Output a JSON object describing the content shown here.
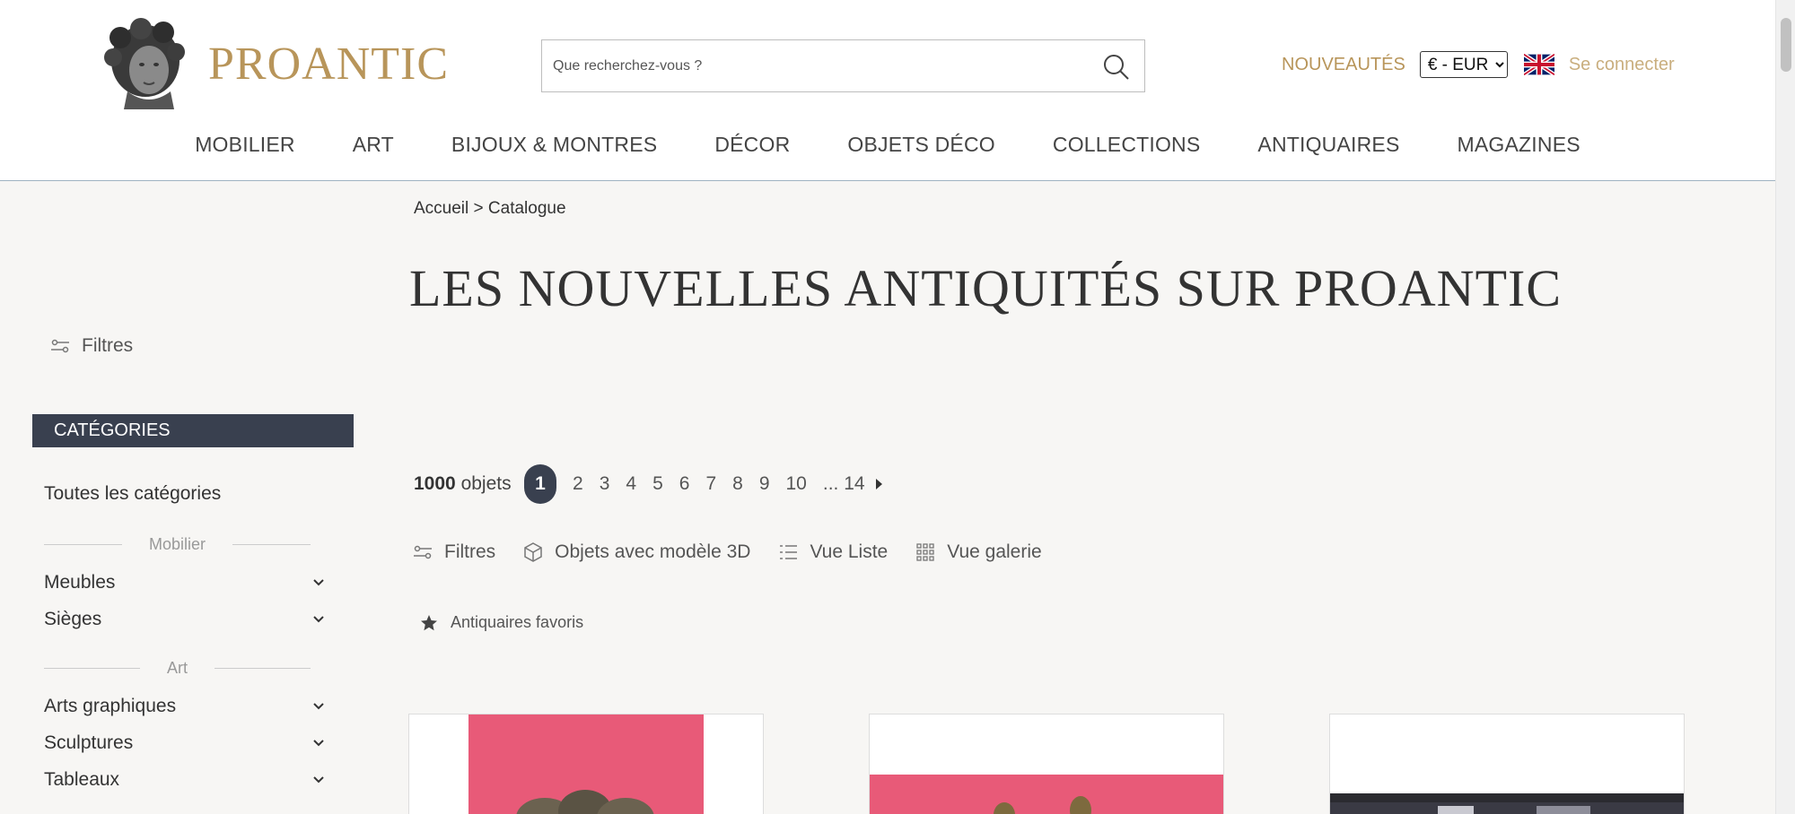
{
  "brand": {
    "name": "PROANTIC",
    "color": "#b8955a"
  },
  "search": {
    "placeholder": "Que recherchez-vous ?"
  },
  "header_right": {
    "news": "NOUVEAUTÉS",
    "currency": "€ - EUR",
    "currency_options": [
      "€ - EUR"
    ],
    "login": "Se connecter"
  },
  "nav": [
    "MOBILIER",
    "ART",
    "BIJOUX & MONTRES",
    "DÉCOR",
    "OBJETS DÉCO",
    "COLLECTIONS",
    "ANTIQUAIRES",
    "MAGAZINES"
  ],
  "breadcrumb": {
    "home": "Accueil",
    "sep": ">",
    "current": "Catalogue"
  },
  "title": "LES NOUVELLES ANTIQUITÉS SUR PROANTIC",
  "sidebar": {
    "filters": "Filtres",
    "categories_header": "CATÉGORIES",
    "all": "Toutes les catégories",
    "groups": [
      {
        "name": "Mobilier",
        "items": [
          "Meubles",
          "Sièges"
        ]
      },
      {
        "name": "Art",
        "items": [
          "Arts graphiques",
          "Sculptures",
          "Tableaux"
        ]
      }
    ]
  },
  "results": {
    "count": "1000",
    "count_suffix": "objets"
  },
  "pagination": {
    "current": "1",
    "pages": [
      "2",
      "3",
      "4",
      "5",
      "6",
      "7",
      "8",
      "9",
      "10"
    ],
    "ellipsis": "... 14"
  },
  "views": {
    "filters": "Filtres",
    "model3d": "Objets avec modèle 3D",
    "list": "Vue Liste",
    "gallery": "Vue galerie"
  },
  "favorites": "Antiquaires favoris",
  "colors": {
    "accent": "#b8955a",
    "dark": "#39404f",
    "background": "#f7f6f4",
    "product_bg": "#e85a78"
  }
}
